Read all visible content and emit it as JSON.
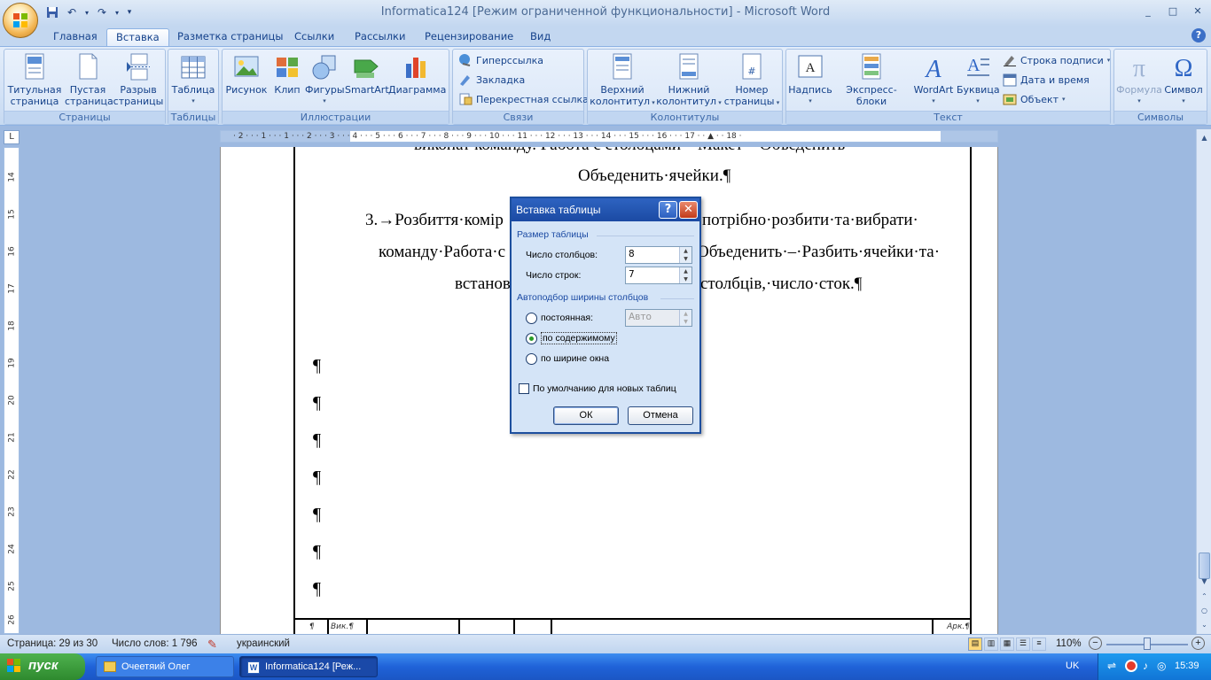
{
  "window": {
    "title": "Informatica124 [Режим ограниченной функциональности] - Microsoft Word",
    "minimize": "_",
    "maximize": "□",
    "close": "✕"
  },
  "qat": {
    "save_icon": "save-icon",
    "undo_icon": "undo-icon",
    "redo_icon": "redo-icon"
  },
  "tabs": [
    {
      "label": "Главная",
      "active": false
    },
    {
      "label": "Вставка",
      "active": true
    },
    {
      "label": "Разметка страницы",
      "active": false
    },
    {
      "label": "Ссылки",
      "active": false
    },
    {
      "label": "Рассылки",
      "active": false
    },
    {
      "label": "Рецензирование",
      "active": false
    },
    {
      "label": "Вид",
      "active": false
    }
  ],
  "ribbon": {
    "pages": {
      "label": "Страницы",
      "cover": [
        "Титульная",
        "страница"
      ],
      "blank": [
        "Пустая",
        "страница"
      ],
      "break": [
        "Разрыв",
        "страницы"
      ]
    },
    "tables": {
      "label": "Таблицы",
      "table": "Таблица"
    },
    "illustrations": {
      "label": "Иллюстрации",
      "picture": "Рисунок",
      "clip": "Клип",
      "shapes": "Фигуры",
      "smartart": "SmartArt",
      "chart": "Диаграмма"
    },
    "links": {
      "label": "Связи",
      "hyperlink": "Гиперссылка",
      "bookmark": "Закладка",
      "crossref": "Перекрестная ссылка"
    },
    "headers": {
      "label": "Колонтитулы",
      "header": [
        "Верхний",
        "колонтитул"
      ],
      "footer": [
        "Нижний",
        "колонтитул"
      ],
      "pagenum": [
        "Номер",
        "страницы"
      ]
    },
    "text": {
      "label": "Текст",
      "textbox": "Надпись",
      "quickparts": "Экспресс-блоки",
      "wordart": "WordArt",
      "dropcap": "Буквица",
      "signature": "Строка подписи",
      "datetime": "Дата и время",
      "object": "Объект"
    },
    "symbols": {
      "label": "Символы",
      "formula": "Формула",
      "symbol": "Символ"
    }
  },
  "document": {
    "line0": "виконат команду. Работа с столоцами – Макет – Объеденить",
    "line1": "Объеденить·ячейки.¶",
    "line2a": "3.→Розбиття·комір",
    "line2b": "потрібно·розбити·та·вибрати·",
    "line3a": "команду·Работа·с",
    "line3b": "Объеденить·–·Разбить·ячейки·та·",
    "line4a": "встанов",
    "line4b": "столбців,·число·сток.¶",
    "pilcrow": "¶",
    "footer_cells": {
      "c0": "¶",
      "c1": "Вик.¶",
      "c_end": "Арк.¶"
    }
  },
  "dialog": {
    "title": "Вставка таблицы",
    "help": "?",
    "close": "✕",
    "section_size": "Размер таблицы",
    "cols_label": "Число столбцов:",
    "cols_value": "8",
    "rows_label": "Число строк:",
    "rows_value": "7",
    "section_autofit": "Автоподбор ширины столбцов",
    "opt_fixed": "постоянная:",
    "opt_fixed_value": "Авто",
    "opt_content": "по содержимому",
    "opt_window": "по ширине окна",
    "default_label": "По умолчанию для новых таблиц",
    "ok": "ОК",
    "cancel": "Отмена"
  },
  "statusbar": {
    "page": "Страница: 29 из 30",
    "words": "Число слов: 1 796",
    "language": "украинский",
    "zoom": "110%"
  },
  "taskbar": {
    "start": "пуск",
    "item1": "Очеетяий Олег",
    "item2": "Informatica124 [Реж...",
    "lang": "UK",
    "time": "15:39"
  },
  "colors": {
    "dialog_title": "#1b4aa3",
    "ribbon": "#d3e2f6",
    "taskbar": "#1f62d8",
    "start": "#2e8a2e"
  }
}
